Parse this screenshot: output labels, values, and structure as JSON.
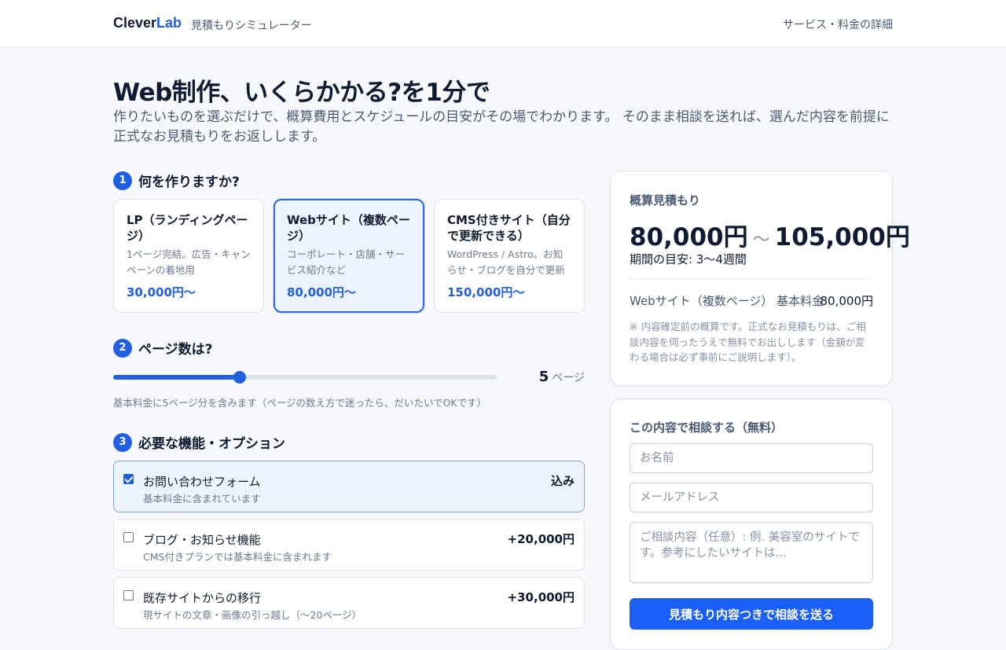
{
  "header": {
    "brand_part1": "Clever",
    "brand_part2": "Lab",
    "subtitle": "見積もりシミュレーター",
    "nav_link": "サービス・料金の詳細"
  },
  "hero": {
    "title": "Web制作、いくらかかる?を1分で",
    "description": "作りたいものを選ぶだけで、概算費用とスケジュールの目安がその場でわかります。 そのまま相談を送れば、選んだ内容を前提に正式なお見積もりをお返しします。"
  },
  "steps": [
    {
      "num": "1",
      "title": "何を作りますか?"
    },
    {
      "num": "2",
      "title": "ページ数は?"
    },
    {
      "num": "3",
      "title": "必要な機能・オプション"
    }
  ],
  "plans": [
    {
      "name": "LP（ランディングページ）",
      "desc": "1ページ完結。広告・キャンペーンの着地用",
      "price": "30,000円〜",
      "selected": false
    },
    {
      "name": "Webサイト（複数ページ）",
      "desc": "コーポレート・店舗・サービス紹介など",
      "price": "80,000円〜",
      "selected": true
    },
    {
      "name": "CMS付きサイト（自分で更新できる）",
      "desc": "WordPress / Astro。お知らせ・ブログを自分で更新",
      "price": "150,000円〜",
      "selected": false
    }
  ],
  "pages": {
    "value": 5,
    "min": 1,
    "max": 20,
    "unit": "ページ",
    "note": "基本料金に5ページ分を含みます（ページの数え方で迷ったら、だいたいでOKです）"
  },
  "options": [
    {
      "name": "お問い合わせフォーム",
      "desc": "基本料金に含まれています",
      "price": "込み",
      "checked": true
    },
    {
      "name": "ブログ・お知らせ機能",
      "desc": "CMS付きプランでは基本料金に含まれます",
      "price": "+20,000円",
      "checked": false
    },
    {
      "name": "既存サイトからの移行",
      "desc": "現サイトの文章・画像の引っ越し（〜20ページ）",
      "price": "+30,000円",
      "checked": false
    }
  ],
  "estimate": {
    "label": "概算見積もり",
    "min": "80,000円",
    "tilde": "〜",
    "max": "105,000円",
    "period": "期間の目安: 3〜4週間",
    "line_label": "Webサイト（複数ページ） 基本料金",
    "line_value": "80,000円",
    "note": "※ 内容確定前の概算です。正式なお見積もりは、ご相談内容を伺ったうえで無料でお出しします（金額が変わる場合は必ず事前にご説明します）。"
  },
  "contact": {
    "title": "この内容で相談する（無料）",
    "name_placeholder": "お名前",
    "email_placeholder": "メールアドレス",
    "message_placeholder": "ご相談内容（任意）: 例. 美容室のサイトです。参考にしたいサイトは…",
    "submit_label": "見積もり内容つきで相談を送る"
  },
  "colors": {
    "accent": "#1f5fe0",
    "button": "#1a5ff7",
    "selected_bg": "#eef4ff"
  }
}
